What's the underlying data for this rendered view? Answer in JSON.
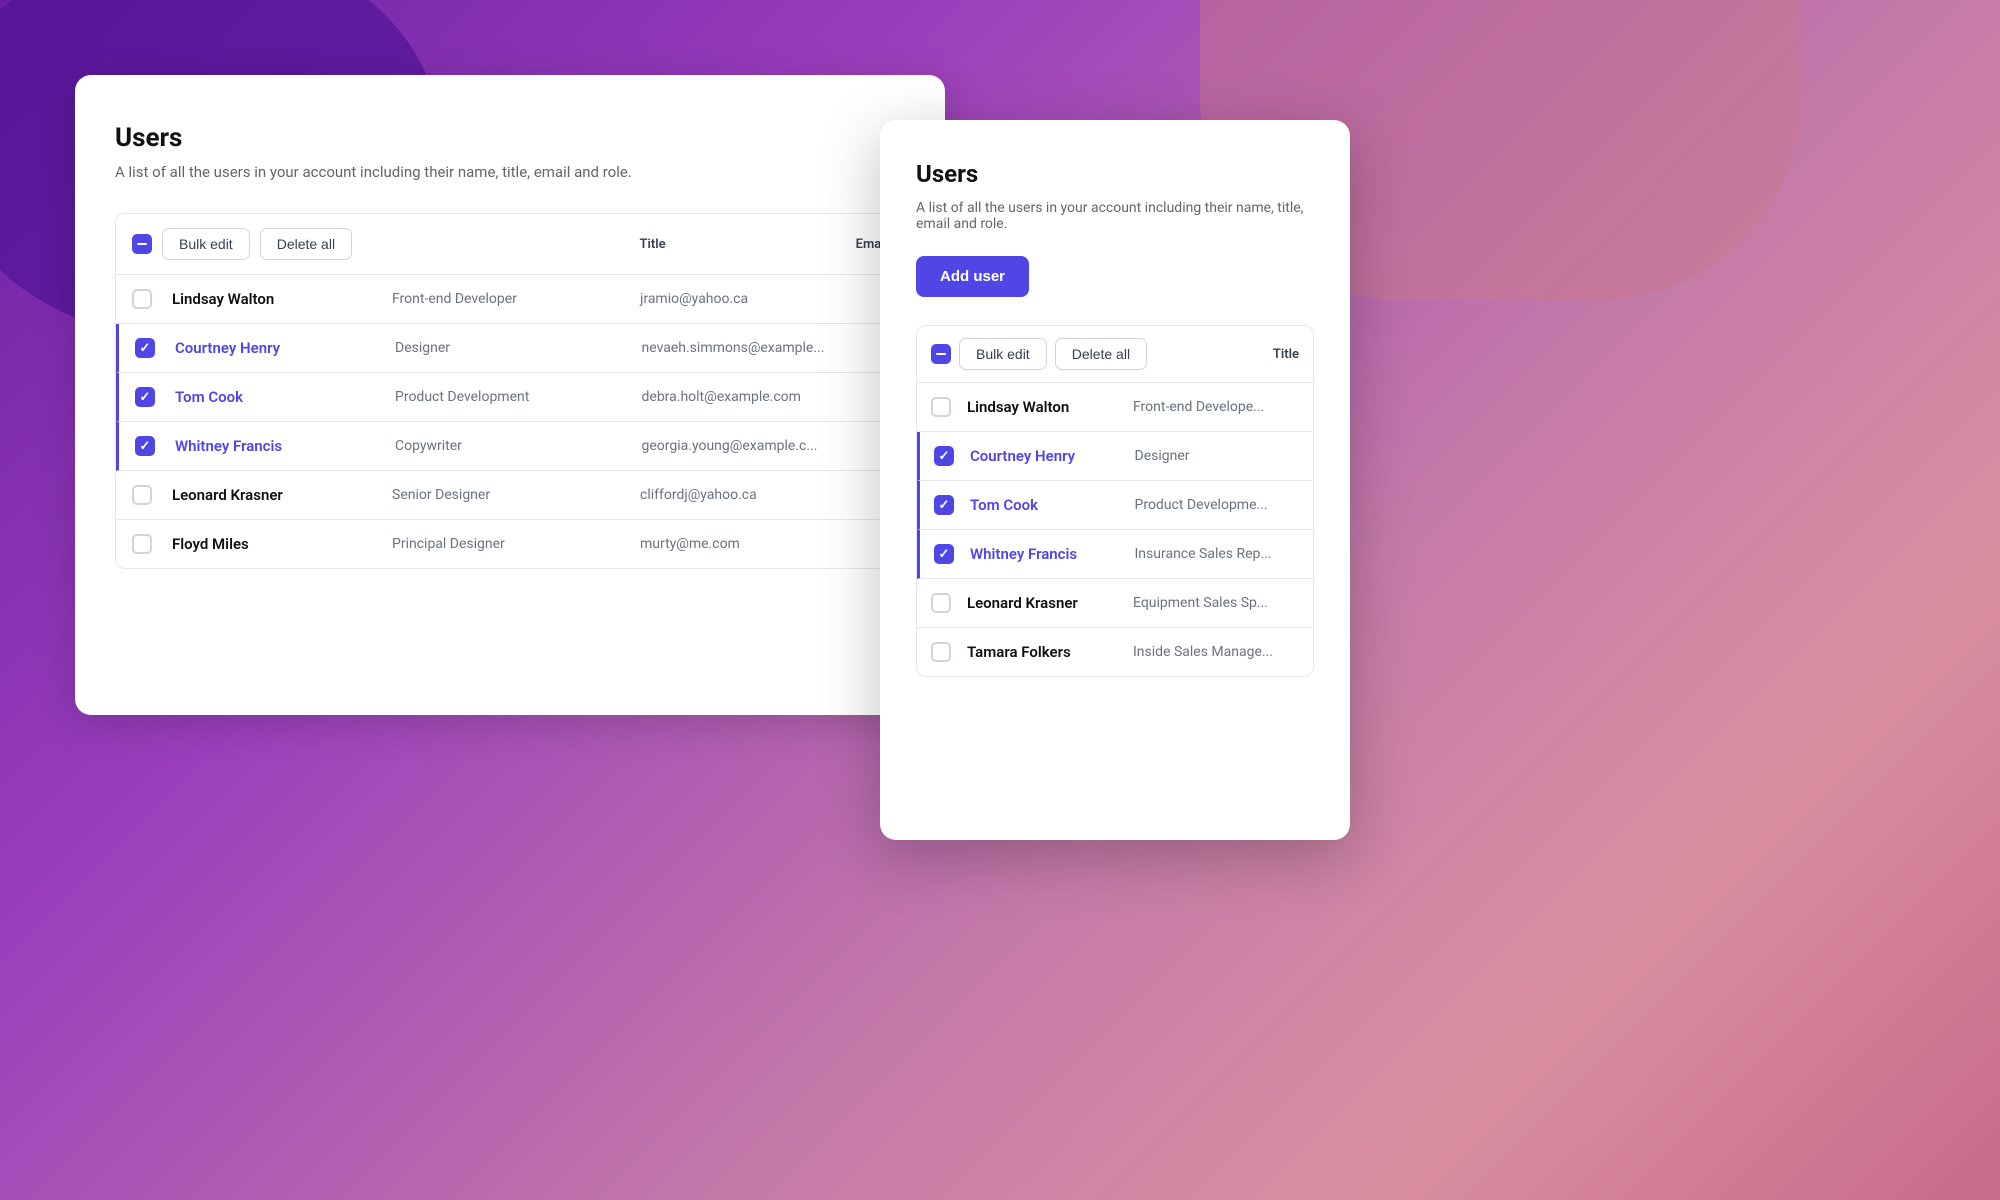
{
  "background": {
    "colors": [
      "#6a1fa3",
      "#9b3fbc",
      "#c47aa8",
      "#d98fa0"
    ]
  },
  "card_back": {
    "title": "Users",
    "subtitle": "A list of all the users in your account including their name, title, email and role.",
    "toolbar": {
      "bulk_edit_label": "Bulk edit",
      "delete_all_label": "Delete all"
    },
    "columns": {
      "title": "Title",
      "email": "Email"
    },
    "rows": [
      {
        "name": "Lindsay Walton",
        "title": "Front-end Developer",
        "email": "jramio@yahoo.ca",
        "selected": false
      },
      {
        "name": "Courtney Henry",
        "title": "Designer",
        "email": "nevaeh.simmons@example...",
        "selected": true
      },
      {
        "name": "Tom Cook",
        "title": "Product Development",
        "email": "debra.holt@example.com",
        "selected": true
      },
      {
        "name": "Whitney Francis",
        "title": "Copywriter",
        "email": "georgia.young@example.c...",
        "selected": true
      },
      {
        "name": "Leonard Krasner",
        "title": "Senior Designer",
        "email": "cliffordj@yahoo.ca",
        "selected": false
      },
      {
        "name": "Floyd Miles",
        "title": "Principal Designer",
        "email": "murty@me.com",
        "selected": false
      }
    ]
  },
  "card_front": {
    "title": "Users",
    "subtitle": "A list of all the users in your account including their name, title, email and role.",
    "add_user_label": "Add user",
    "toolbar": {
      "bulk_edit_label": "Bulk edit",
      "delete_all_label": "Delete all"
    },
    "columns": {
      "title": "Title"
    },
    "rows": [
      {
        "name": "Lindsay Walton",
        "title": "Front-end Develope...",
        "selected": false
      },
      {
        "name": "Courtney Henry",
        "title": "Designer",
        "selected": true
      },
      {
        "name": "Tom Cook",
        "title": "Product Developme...",
        "selected": true
      },
      {
        "name": "Whitney Francis",
        "title": "Insurance Sales Rep...",
        "selected": true
      },
      {
        "name": "Leonard Krasner",
        "title": "Equipment Sales Sp...",
        "selected": false
      },
      {
        "name": "Tamara Folkers",
        "title": "Inside Sales Manage...",
        "selected": false
      }
    ]
  }
}
